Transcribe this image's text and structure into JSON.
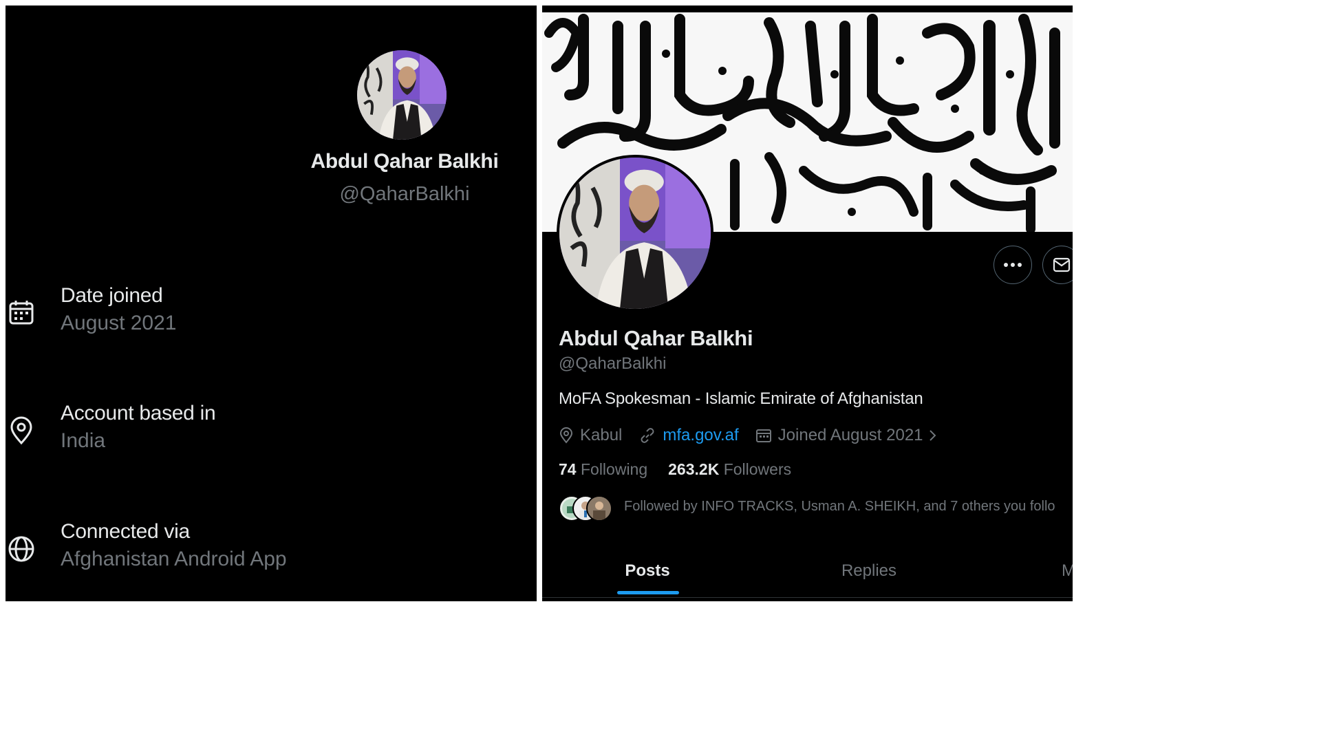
{
  "left": {
    "profile": {
      "name": "Abdul Qahar Balkhi",
      "handle": "@QaharBalkhi",
      "avatar_icon": "avatar-photo"
    },
    "about": [
      {
        "icon": "calendar-icon",
        "label": "Date joined",
        "value": "August 2021"
      },
      {
        "icon": "location-pin-icon",
        "label": "Account based in",
        "value": "India"
      },
      {
        "icon": "globe-icon",
        "label": "Connected via",
        "value": "Afghanistan Android App"
      }
    ]
  },
  "right": {
    "banner_icon": "calligraphy-banner",
    "profile": {
      "name": "Abdul Qahar Balkhi",
      "handle": "@QaharBalkhi",
      "bio": "MoFA Spokesman - Islamic Emirate of Afghanistan",
      "location": "Kabul",
      "website": "mfa.gov.af",
      "joined": "Joined August 2021",
      "following_count": "74",
      "following_label": "Following",
      "followers_count": "263.2K",
      "followers_label": "Followers",
      "followed_by": "Followed by INFO TRACKS, Usman A. SHEIKH, and 7 others you follo"
    },
    "actions": {
      "more_icon": "more-dots-icon",
      "message_icon": "envelope-icon"
    },
    "tabs": [
      "Posts",
      "Replies",
      "M"
    ],
    "active_tab": "Posts"
  },
  "colors": {
    "background": "#000000",
    "primary_text": "#e7e9ea",
    "secondary_text": "#71767b",
    "accent": "#1d9bf0",
    "border": "#2f3336"
  }
}
